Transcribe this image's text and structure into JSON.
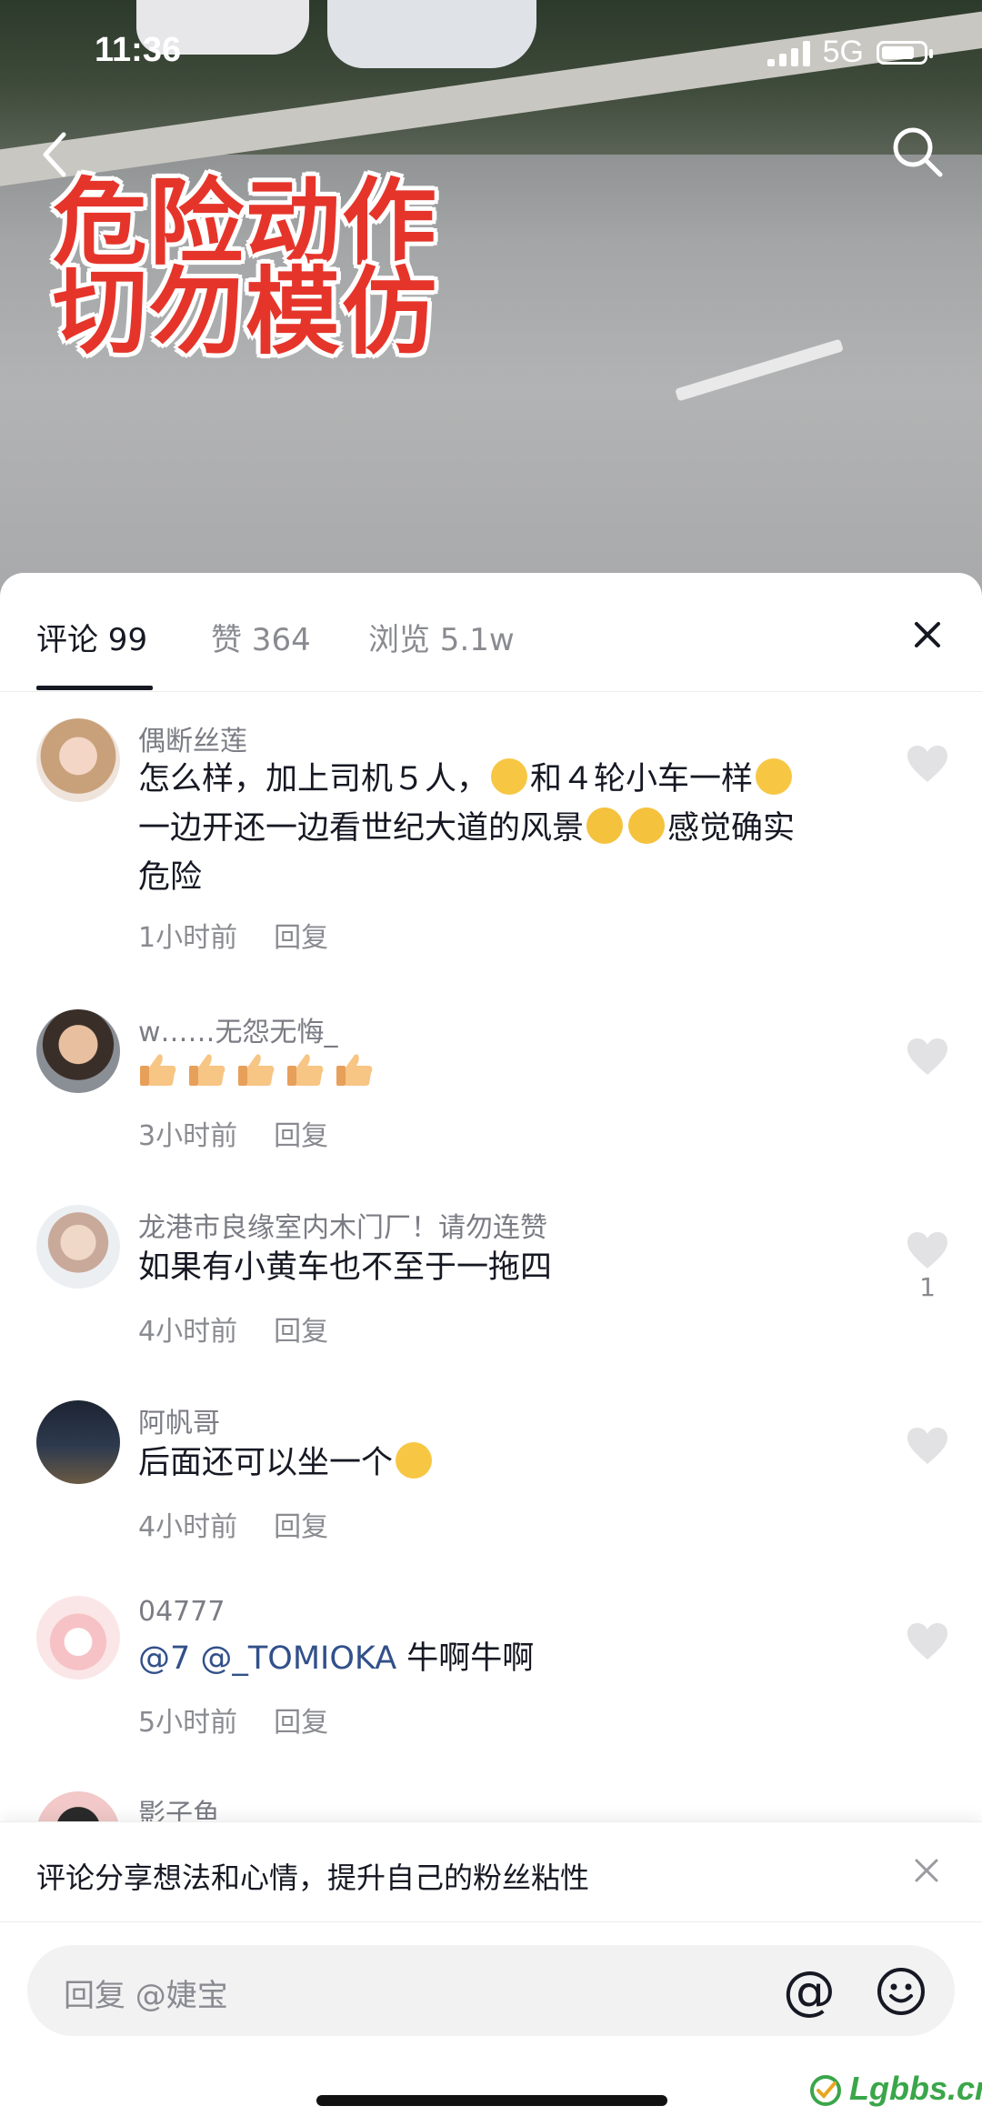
{
  "status": {
    "time": "11:36",
    "network": "5G"
  },
  "video": {
    "overlay_line1": "危险动作",
    "overlay_line2": "切勿模仿"
  },
  "tabs": [
    {
      "label": "评论 99",
      "active": true
    },
    {
      "label": "赞 364",
      "active": false
    },
    {
      "label": "浏览 5.1w",
      "active": false
    }
  ],
  "comments": [
    {
      "user": "偶断丝莲",
      "text_line1_a": "怎么样，加上司机５人，",
      "text_line1_b": "和４轮小车一样",
      "text_line2_a": "一边开还一边看世纪大道的风景",
      "text_line2_b": "感觉确实",
      "text_line3": "危险",
      "time": "1小时前",
      "reply": "回复"
    },
    {
      "user": "w……无怨无悔_",
      "text": "",
      "time": "3小时前",
      "reply": "回复"
    },
    {
      "user": "龙港市良缘室内木门厂！请勿连赞",
      "text": "如果有小黄车也不至于一拖四",
      "time": "4小时前",
      "reply": "回复",
      "likes": "1"
    },
    {
      "user": "阿帆哥",
      "text": "后面还可以坐一个",
      "time": "4小时前",
      "reply": "回复"
    },
    {
      "user": "04777",
      "mention": "@7 @_TOMIOKA",
      "text": " 牛啊牛啊",
      "time": "5小时前",
      "reply": "回复"
    },
    {
      "user": "影子鱼"
    }
  ],
  "tip": {
    "text": "评论分享想法和心情，提升自己的粉丝粘性"
  },
  "input": {
    "placeholder": "回复 @婕宝",
    "at_symbol": "@"
  },
  "watermark": {
    "text": "Lgbbs.cn"
  },
  "colors": {
    "overlay_red": "#e5352b",
    "mention_blue": "#32508a",
    "like_gray": "#e2e2e4"
  }
}
